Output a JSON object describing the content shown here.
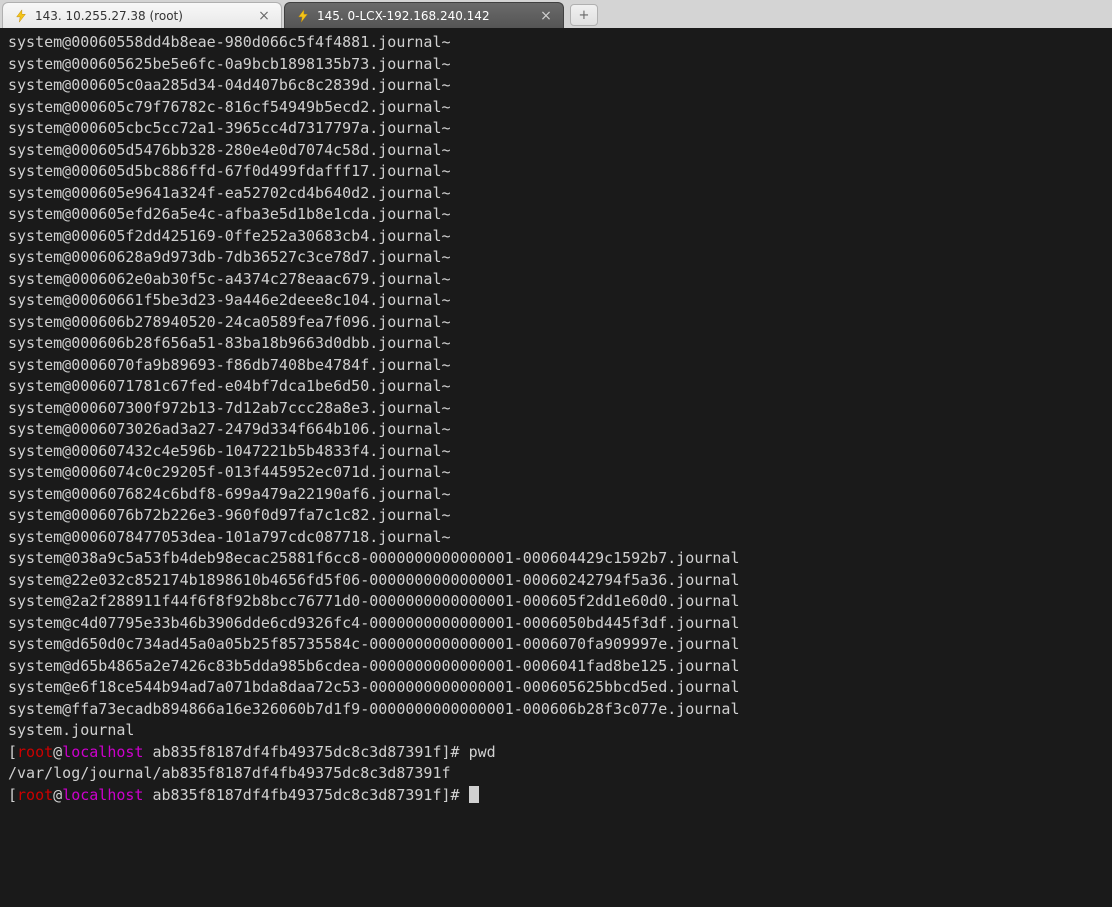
{
  "tabs": [
    {
      "label": "143. 10.255.27.38 (root)",
      "active": false
    },
    {
      "label": "145. 0-LCX-192.168.240.142",
      "active": true
    }
  ],
  "terminal": {
    "lines": [
      "system@00060558dd4b8eae-980d066c5f4f4881.journal~",
      "system@000605625be5e6fc-0a9bcb1898135b73.journal~",
      "system@000605c0aa285d34-04d407b6c8c2839d.journal~",
      "system@000605c79f76782c-816cf54949b5ecd2.journal~",
      "system@000605cbc5cc72a1-3965cc4d7317797a.journal~",
      "system@000605d5476bb328-280e4e0d7074c58d.journal~",
      "system@000605d5bc886ffd-67f0d499fdafff17.journal~",
      "system@000605e9641a324f-ea52702cd4b640d2.journal~",
      "system@000605efd26a5e4c-afba3e5d1b8e1cda.journal~",
      "system@000605f2dd425169-0ffe252a30683cb4.journal~",
      "system@00060628a9d973db-7db36527c3ce78d7.journal~",
      "system@0006062e0ab30f5c-a4374c278eaac679.journal~",
      "system@00060661f5be3d23-9a446e2deee8c104.journal~",
      "system@000606b278940520-24ca0589fea7f096.journal~",
      "system@000606b28f656a51-83ba18b9663d0dbb.journal~",
      "system@0006070fa9b89693-f86db7408be4784f.journal~",
      "system@0006071781c67fed-e04bf7dca1be6d50.journal~",
      "system@000607300f972b13-7d12ab7ccc28a8e3.journal~",
      "system@0006073026ad3a27-2479d334f664b106.journal~",
      "system@000607432c4e596b-1047221b5b4833f4.journal~",
      "system@0006074c0c29205f-013f445952ec071d.journal~",
      "system@0006076824c6bdf8-699a479a22190af6.journal~",
      "system@0006076b72b226e3-960f0d97fa7c1c82.journal~",
      "system@0006078477053dea-101a797cdc087718.journal~",
      "system@038a9c5a53fb4deb98ecac25881f6cc8-0000000000000001-000604429c1592b7.journal",
      "system@22e032c852174b1898610b4656fd5f06-0000000000000001-00060242794f5a36.journal",
      "system@2a2f288911f44f6f8f92b8bcc76771d0-0000000000000001-000605f2dd1e60d0.journal",
      "system@c4d07795e33b46b3906dde6cd9326fc4-0000000000000001-0006050bd445f3df.journal",
      "system@d650d0c734ad45a0a05b25f85735584c-0000000000000001-0006070fa909997e.journal",
      "system@d65b4865a2e7426c83b5dda985b6cdea-0000000000000001-0006041fad8be125.journal",
      "system@e6f18ce544b94ad7a071bda8daa72c53-0000000000000001-000605625bbcd5ed.journal",
      "system@ffa73ecadb894866a16e326060b7d1f9-0000000000000001-000606b28f3c077e.journal",
      "system.journal"
    ],
    "prompt": {
      "user": "root",
      "host": "localhost",
      "cwd": "ab835f8187df4fb49375dc8c3d87391f",
      "symbol": "#"
    },
    "command1": "pwd",
    "output1": "/var/log/journal/ab835f8187df4fb49375dc8c3d87391f",
    "command2": ""
  }
}
